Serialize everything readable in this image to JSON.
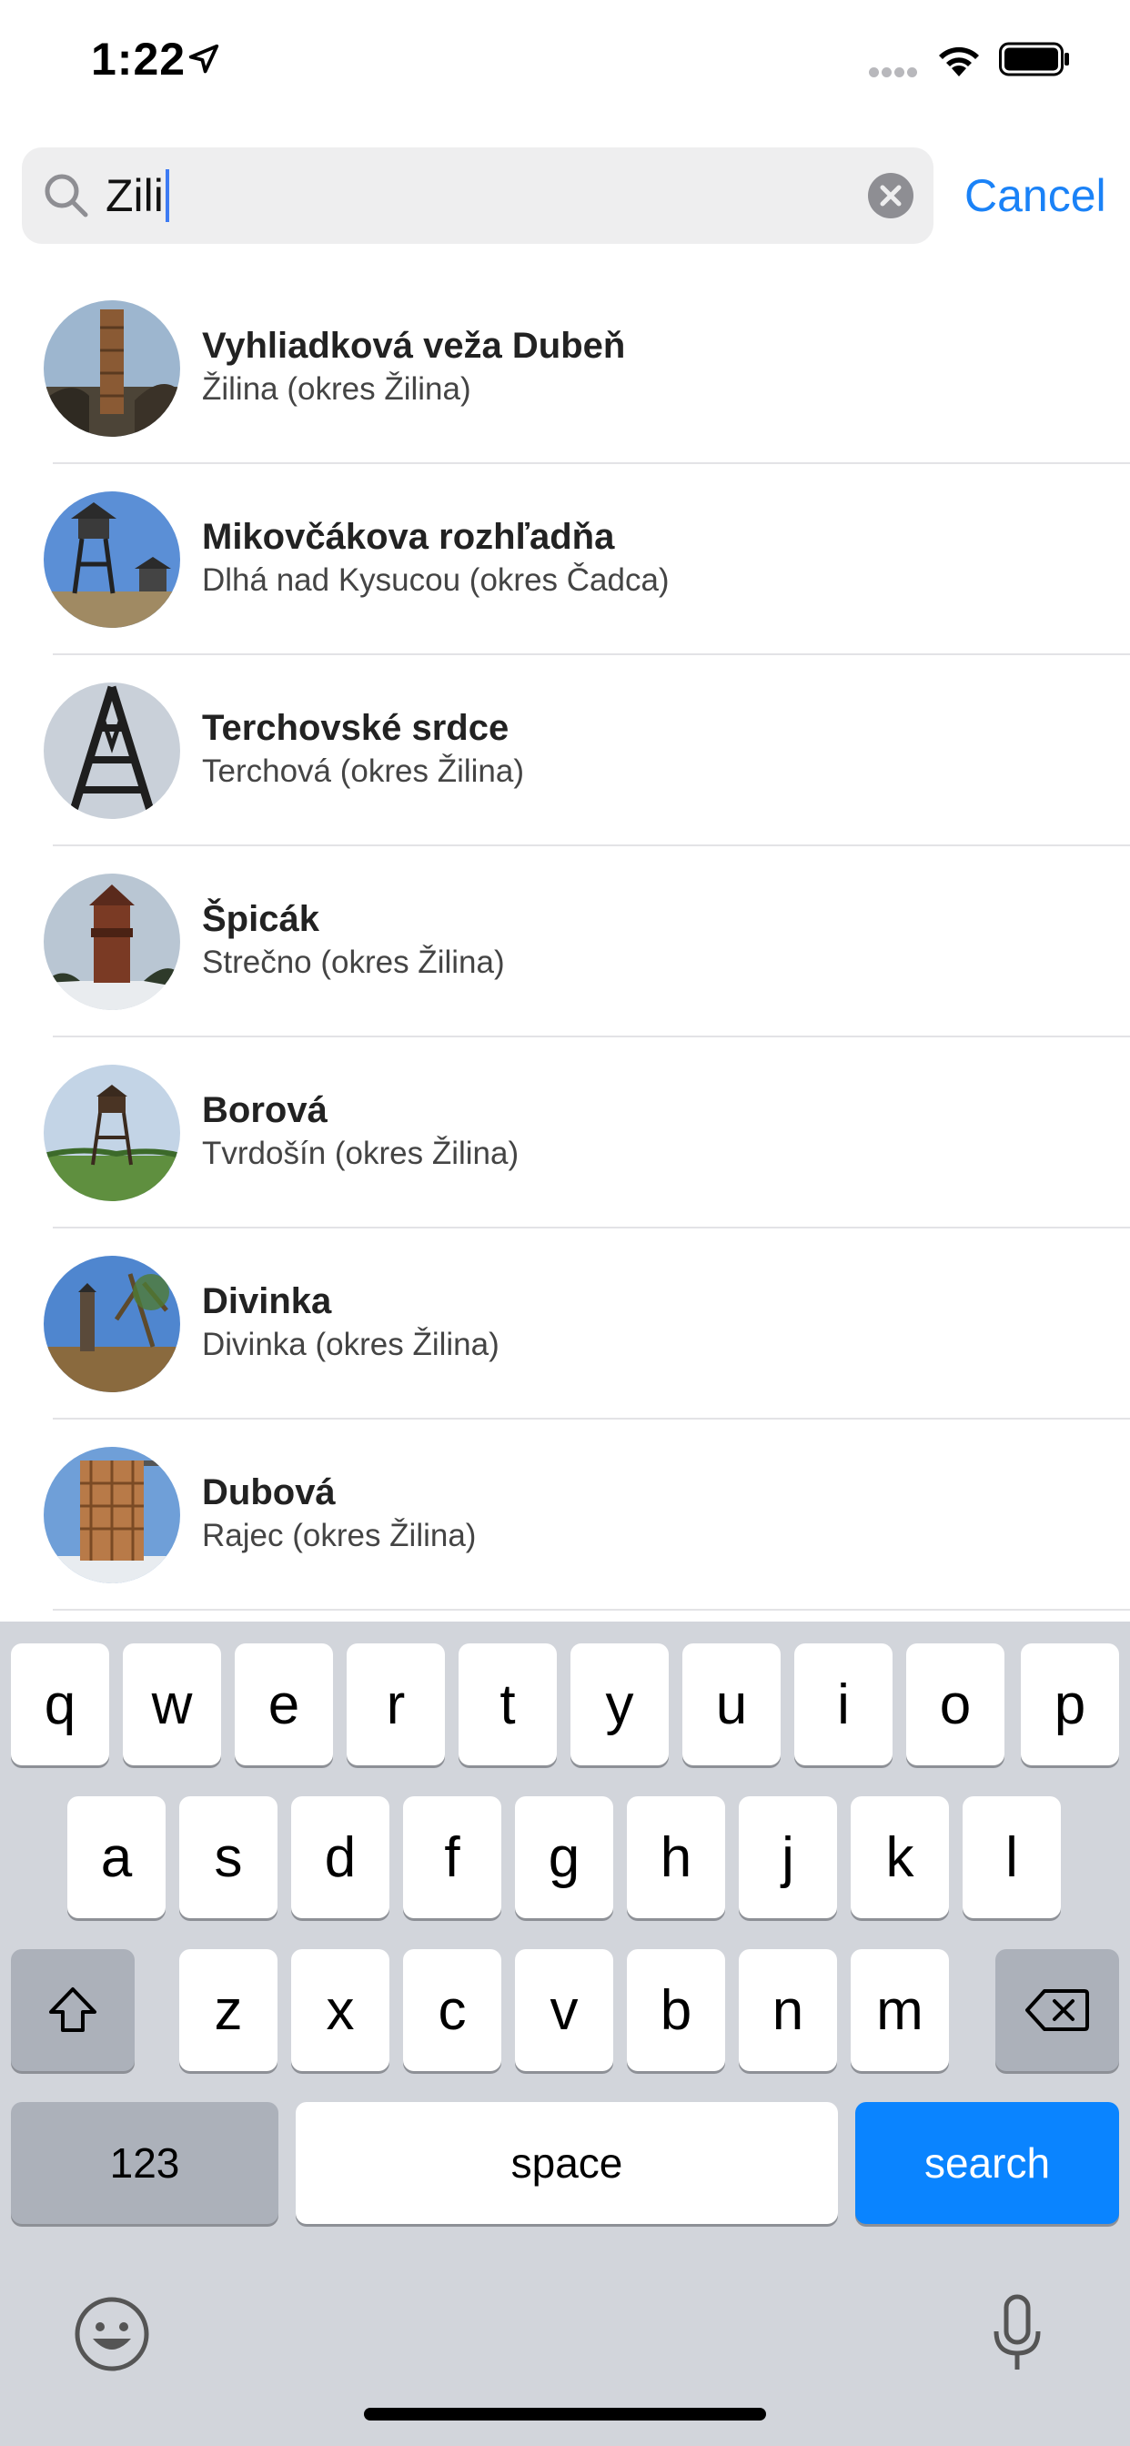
{
  "status_bar": {
    "time": "1:22"
  },
  "search": {
    "value": "Zili",
    "cancel_label": "Cancel"
  },
  "results": [
    {
      "title": "Vyhliadková veža Dubeň",
      "subtitle": "Žilina (okres Žilina)"
    },
    {
      "title": "Mikovčákova rozhľadňa",
      "subtitle": "Dlhá nad Kysucou (okres Čadca)"
    },
    {
      "title": "Terchovské srdce",
      "subtitle": "Terchová (okres Žilina)"
    },
    {
      "title": "Špicák",
      "subtitle": "Strečno (okres Žilina)"
    },
    {
      "title": "Borová",
      "subtitle": "Tvrdošín (okres Žilina)"
    },
    {
      "title": "Divinka",
      "subtitle": "Divinka (okres Žilina)"
    },
    {
      "title": "Dubová",
      "subtitle": "Rajec (okres Žilina)"
    }
  ],
  "keyboard": {
    "row1": [
      "q",
      "w",
      "e",
      "r",
      "t",
      "y",
      "u",
      "i",
      "o",
      "p"
    ],
    "row2": [
      "a",
      "s",
      "d",
      "f",
      "g",
      "h",
      "j",
      "k",
      "l"
    ],
    "row3": [
      "z",
      "x",
      "c",
      "v",
      "b",
      "n",
      "m"
    ],
    "numbers_label": "123",
    "space_label": "space",
    "search_label": "search"
  },
  "colors": {
    "accent": "#1a82f7",
    "search_key": "#0a84ff",
    "keyboard_bg": "#d2d5db"
  }
}
